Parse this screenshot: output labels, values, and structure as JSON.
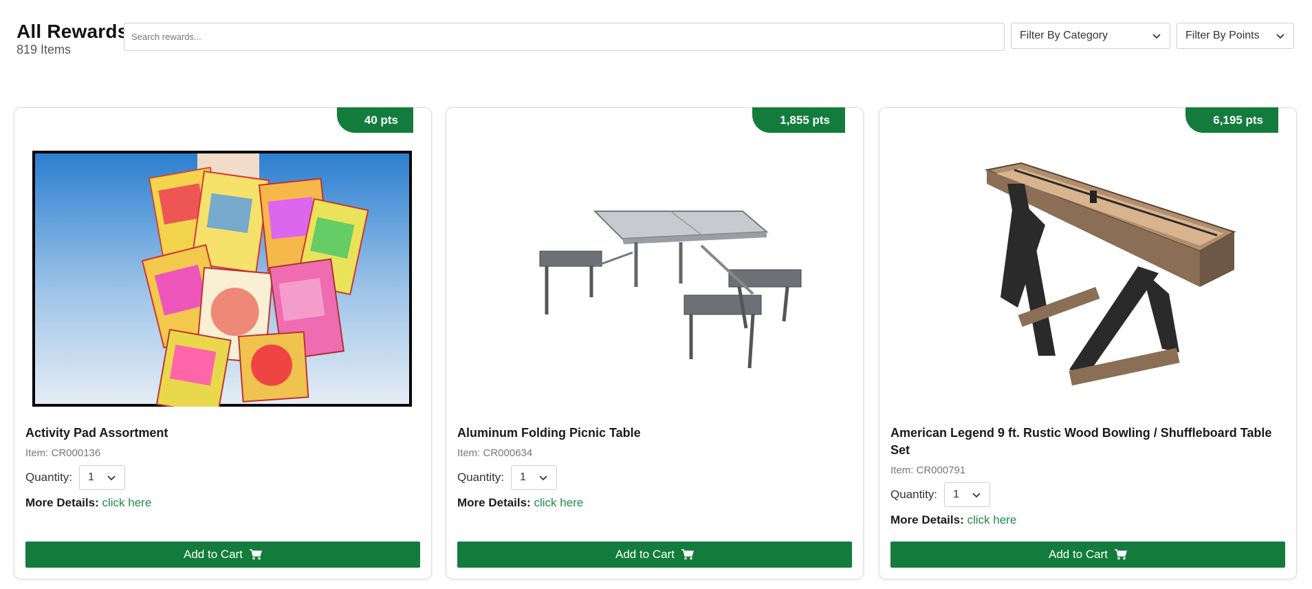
{
  "header": {
    "title": "All Rewards",
    "count": "819 Items",
    "search_placeholder": "Search rewards...",
    "filter_category": "Filter By Category",
    "filter_points": "Filter By Points"
  },
  "labels": {
    "quantity": "Quantity:",
    "more_details": "More Details:",
    "click_here": "click here",
    "add_to_cart": "Add to Cart"
  },
  "products": [
    {
      "points": "40 pts",
      "name": "Activity Pad Assortment",
      "item": "Item: CR000136",
      "quantity": "1",
      "image": "activity-pads-photo"
    },
    {
      "points": "1,855 pts",
      "name": "Aluminum Folding Picnic Table",
      "item": "Item: CR000634",
      "quantity": "1",
      "image": "picnic-table-photo"
    },
    {
      "points": "6,195 pts",
      "name": "American Legend 9 ft. Rustic Wood Bowling / Shuffleboard Table Set",
      "item": "Item: CR000791",
      "quantity": "1",
      "image": "shuffleboard-table-photo"
    }
  ],
  "colors": {
    "brand_green": "#137c3c",
    "link_green": "#1f8a47"
  }
}
